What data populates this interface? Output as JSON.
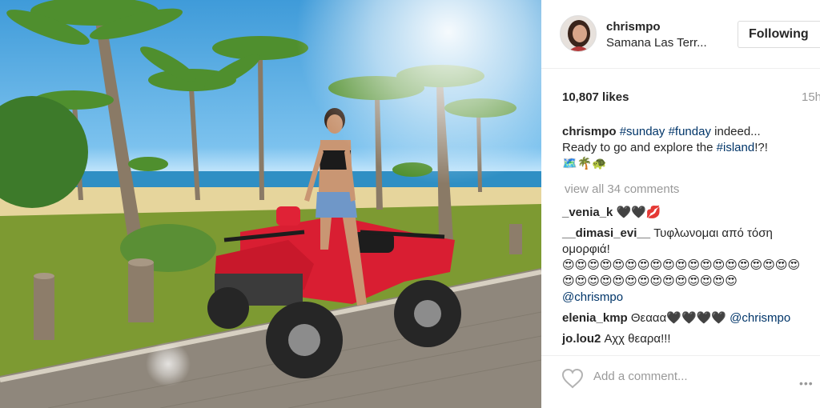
{
  "post": {
    "username": "chrismpo",
    "location": "Samana Las Terr...",
    "follow_label": "Following",
    "likes": "10,807 likes",
    "timestamp": "15h",
    "caption_user": "chrismpo",
    "caption_tag_sunday": "#sunday",
    "caption_tag_funday": "#funday",
    "caption_text_1": "indeed...",
    "caption_text_2": "Ready to go and explore the",
    "caption_tag_island": "#island",
    "caption_text_3": "!?!",
    "caption_emoji": "🗺️🌴🐢"
  },
  "comments": {
    "view_all": "view all 34 comments",
    "items": [
      {
        "user": "_venia_k",
        "text": "🖤🖤💋"
      },
      {
        "user": "__dimasi_evi__",
        "text": "Τυφλωνομαι από τόση ομορφιά!",
        "emoji_line": "😍😍😍😍😍😍😍😍😍😍😍😍😍😍😍😍😍😍😍😍😍😍😍😍😍😍😍😍😍😍😍😍😍",
        "mention": "@chrismpo"
      },
      {
        "user": "elenia_kmp",
        "text": "Θεααα🖤🖤🖤🖤",
        "mention": "@chrismpo"
      },
      {
        "user": "jo.lou2",
        "text": "Αχχ θεαρα!!!"
      }
    ]
  },
  "footer": {
    "add_comment_placeholder": "Add a comment...",
    "more_label": "•••"
  },
  "icons": {
    "like": "heart-outline-icon",
    "more": "more-options-icon"
  },
  "colors": {
    "text": "#262626",
    "muted": "#999999",
    "link": "#003569",
    "border": "#dbdbdb"
  }
}
